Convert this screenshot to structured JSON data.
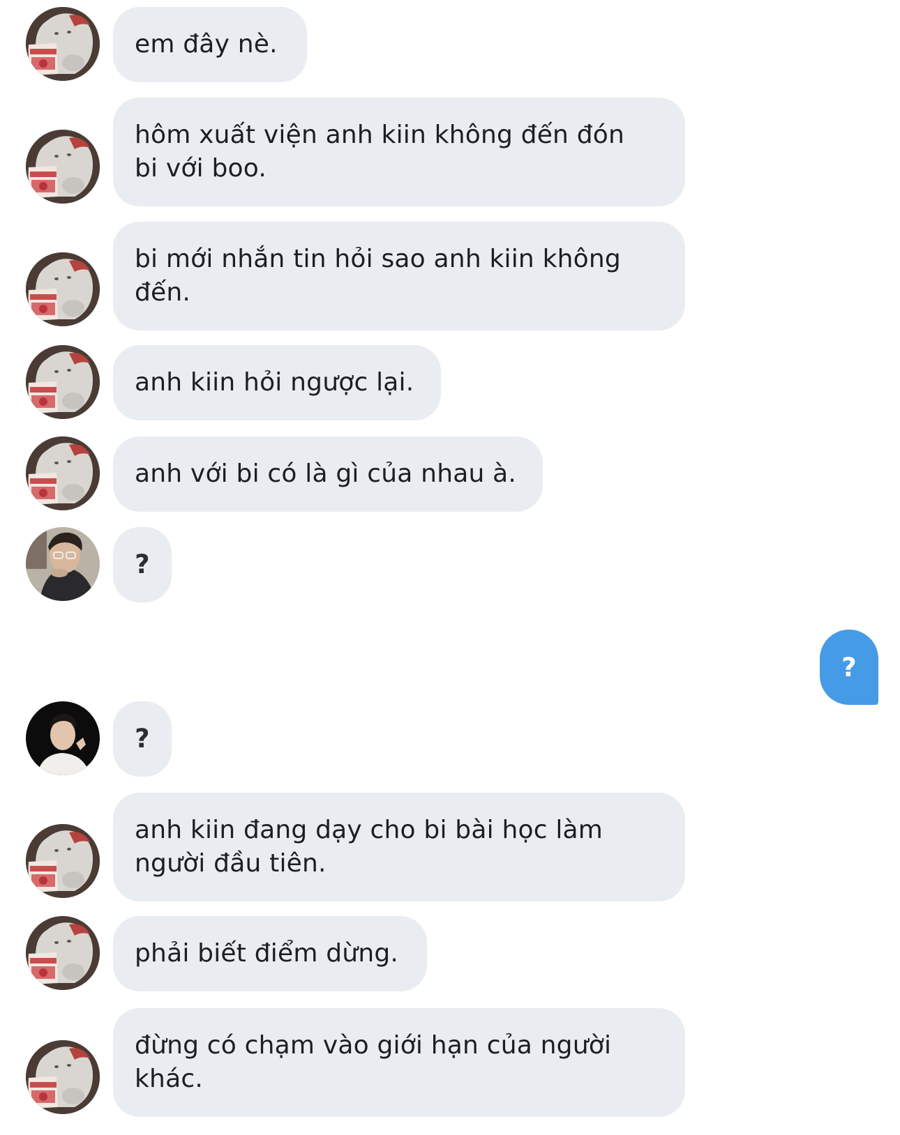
{
  "colors": {
    "incoming_bubble": "#e9ecf0",
    "outgoing_bubble": "#459be6",
    "text": "#1c1e21"
  },
  "messages": [
    {
      "sender": "bear-avatar",
      "text": "em đây nè."
    },
    {
      "sender": "bear-avatar",
      "text": "hôm xuất viện anh kiin không đến đón\nbi với boo."
    },
    {
      "sender": "bear-avatar",
      "text": "bi mới nhắn tin hỏi sao anh kiin không\nđến."
    },
    {
      "sender": "bear-avatar",
      "text": "anh kiin hỏi ngược lại."
    },
    {
      "sender": "bear-avatar",
      "text": "anh với bi có là gì của nhau à."
    },
    {
      "sender": "photo-avatar-glasses",
      "text": "?"
    },
    {
      "sender": "me",
      "text": "?"
    },
    {
      "sender": "photo-avatar-dark",
      "text": "?"
    },
    {
      "sender": "bear-avatar",
      "text": "anh kiin đang dạy cho bi bài học làm\nngười đầu tiên."
    },
    {
      "sender": "bear-avatar",
      "text": "phải biết điểm dừng."
    },
    {
      "sender": "bear-avatar",
      "text": "đừng có chạm vào giới hạn của người\nkhác."
    }
  ]
}
